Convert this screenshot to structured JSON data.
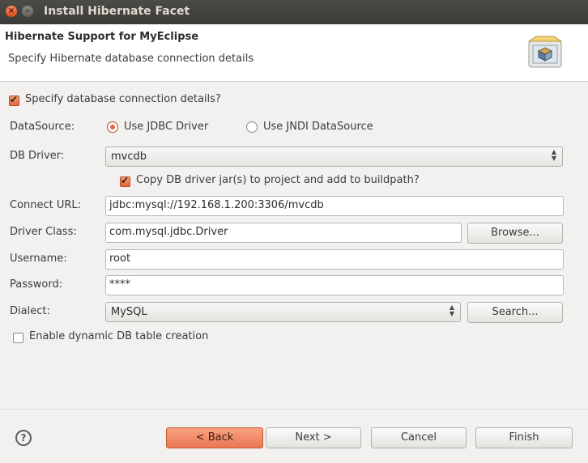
{
  "window": {
    "title": "Install Hibernate Facet"
  },
  "header": {
    "title": "Hibernate Support for MyEclipse",
    "subtitle": "Specify Hibernate database connection details",
    "icon": "facet-box-icon"
  },
  "form": {
    "specify_details": {
      "label": "Specify database connection details?",
      "checked": true
    },
    "datasource": {
      "label": "DataSource:",
      "options": [
        {
          "label": "Use JDBC Driver",
          "selected": true
        },
        {
          "label": "Use JNDI DataSource",
          "selected": false
        }
      ]
    },
    "db_driver": {
      "label": "DB Driver:",
      "value": "mvcdb"
    },
    "copy_jars": {
      "label": "Copy DB driver jar(s) to project and add to buildpath?",
      "checked": true
    },
    "connect_url": {
      "label": "Connect URL:",
      "value": "jdbc:mysql://192.168.1.200:3306/mvcdb"
    },
    "driver_class": {
      "label": "Driver Class:",
      "value": "com.mysql.jdbc.Driver",
      "button": "Browse..."
    },
    "username": {
      "label": "Username:",
      "value": "root"
    },
    "password": {
      "label": "Password:",
      "value": "****"
    },
    "dialect": {
      "label": "Dialect:",
      "value": "MySQL",
      "button": "Search..."
    },
    "dynamic_table": {
      "label": "Enable dynamic DB table creation",
      "checked": false
    }
  },
  "footer": {
    "help": "?",
    "back": "< Back",
    "next": "Next >",
    "cancel": "Cancel",
    "finish": "Finish"
  },
  "colors": {
    "accent": "#e2683a",
    "titlebar": "#3b3a36"
  }
}
